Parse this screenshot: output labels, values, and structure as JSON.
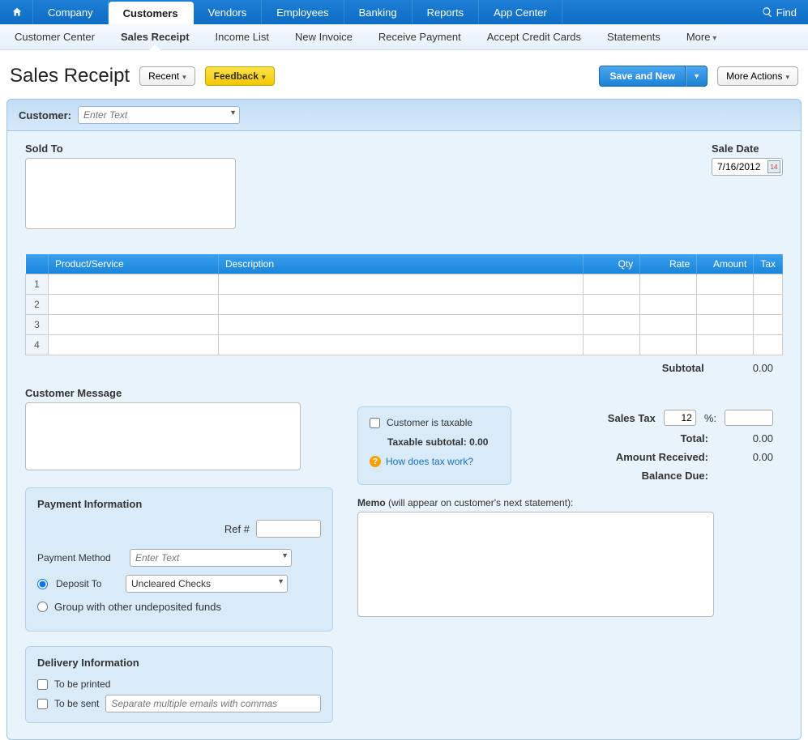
{
  "topnav": {
    "tabs": [
      "Company",
      "Customers",
      "Vendors",
      "Employees",
      "Banking",
      "Reports",
      "App Center"
    ],
    "active": "Customers",
    "find": "Find"
  },
  "subnav": {
    "items": [
      "Customer Center",
      "Sales Receipt",
      "Income List",
      "New Invoice",
      "Receive Payment",
      "Accept Credit Cards",
      "Statements"
    ],
    "active": "Sales Receipt",
    "more": "More"
  },
  "titlebar": {
    "title": "Sales Receipt",
    "recent": "Recent",
    "feedback": "Feedback",
    "save": "Save and New",
    "more_actions": "More Actions"
  },
  "customer": {
    "label": "Customer:",
    "placeholder": "Enter Text"
  },
  "soldto": {
    "label": "Sold To"
  },
  "saledate": {
    "label": "Sale Date",
    "value": "7/16/2012"
  },
  "grid": {
    "headers": {
      "prod": "Product/Service",
      "desc": "Description",
      "qty": "Qty",
      "rate": "Rate",
      "amount": "Amount",
      "tax": "Tax"
    },
    "rows": [
      1,
      2,
      3,
      4
    ]
  },
  "subtotal": {
    "label": "Subtotal",
    "value": "0.00"
  },
  "custmsg": {
    "label": "Customer Message"
  },
  "taxbox": {
    "taxable": "Customer is taxable",
    "subtotal": "Taxable subtotal: 0.00",
    "help": "How does tax work?"
  },
  "totals": {
    "sales_tax_label": "Sales Tax",
    "sales_tax_pct": "12",
    "pct_sym": "%:",
    "total_label": "Total:",
    "total_val": "0.00",
    "amount_recv_label": "Amount Received:",
    "amount_recv_val": "0.00",
    "balance_label": "Balance Due:"
  },
  "payment": {
    "title": "Payment Information",
    "ref_label": "Ref #",
    "method_label": "Payment Method",
    "method_placeholder": "Enter Text",
    "deposit_label": "Deposit To",
    "deposit_value": "Uncleared Checks",
    "group_label": "Group with other undeposited funds"
  },
  "delivery": {
    "title": "Delivery Information",
    "printed": "To be printed",
    "sent": "To be sent",
    "email_placeholder": "Separate multiple emails with commas"
  },
  "memo": {
    "label_bold": "Memo",
    "label_rest": " (will appear on customer's next statement):"
  }
}
